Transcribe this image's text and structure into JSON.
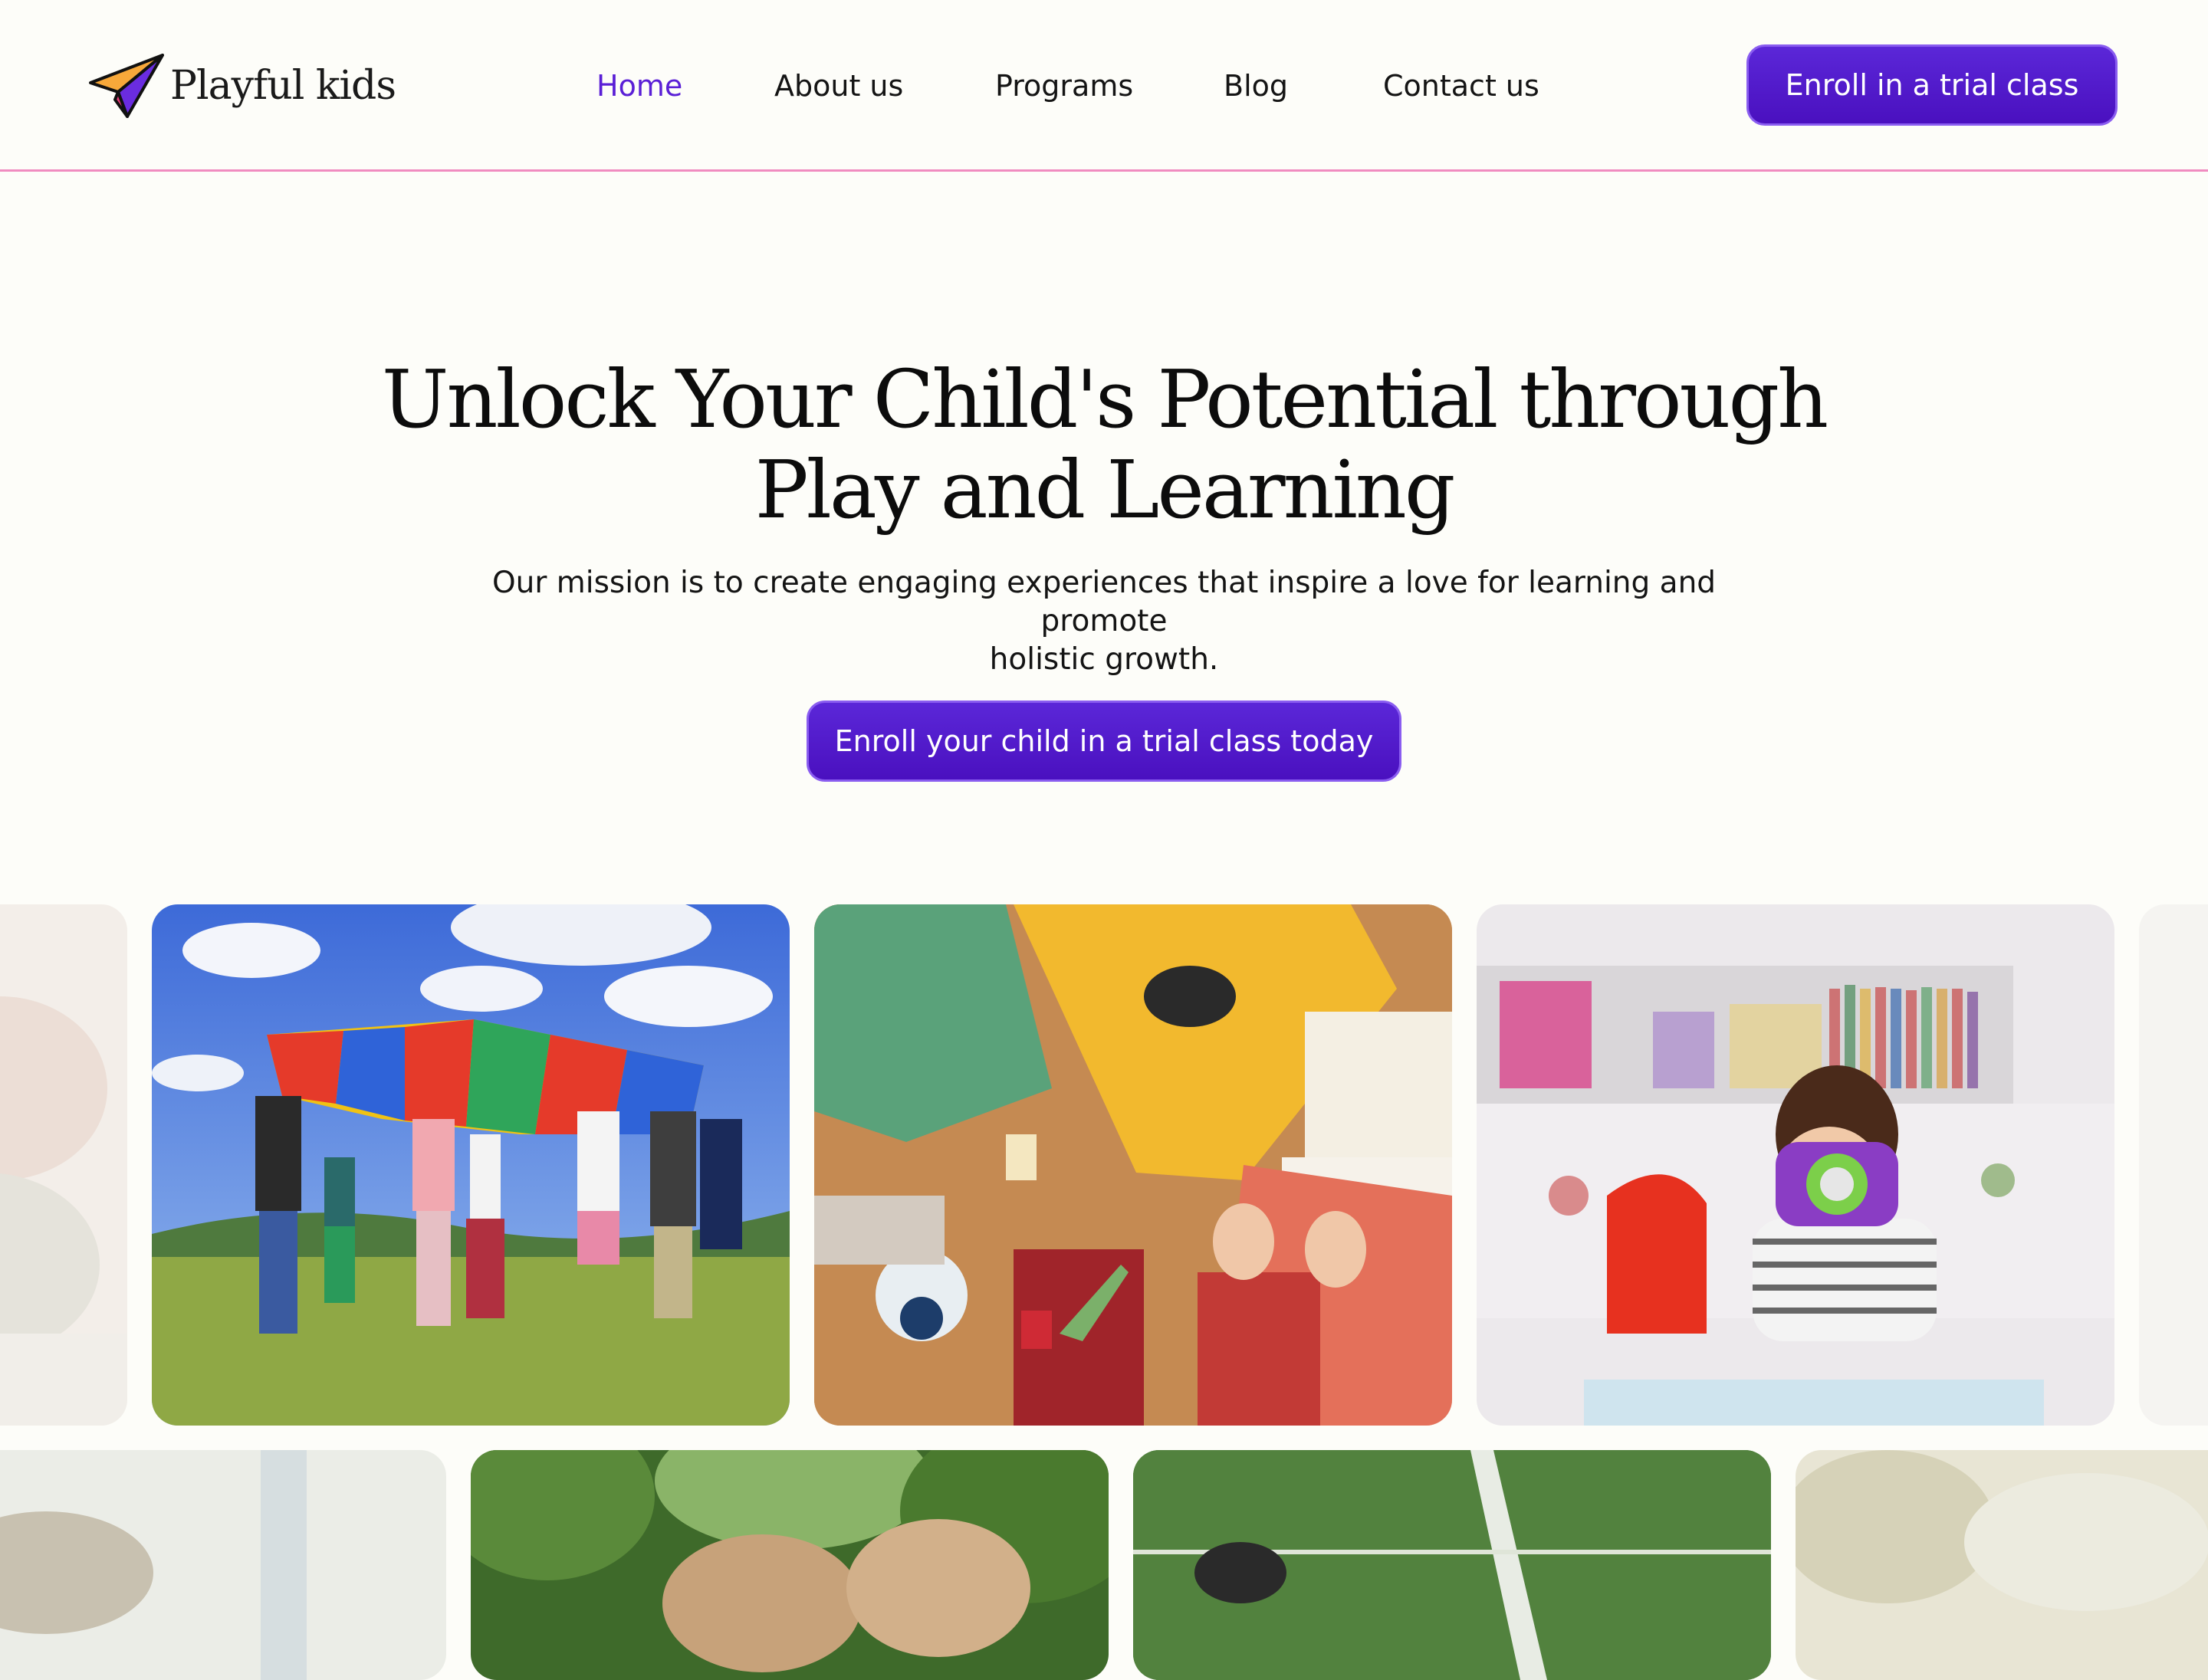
{
  "brand": {
    "name": "Playful kids",
    "colors": {
      "primary": "#4a10bf",
      "primary_light": "#8a5df0",
      "accent_line": "#f08cc0",
      "background": "#fdfdf9"
    }
  },
  "nav": {
    "items": [
      {
        "label": "Home",
        "active": true
      },
      {
        "label": "About us",
        "active": false
      },
      {
        "label": "Programs",
        "active": false
      },
      {
        "label": "Blog",
        "active": false
      },
      {
        "label": "Contact us",
        "active": false
      }
    ]
  },
  "header_cta": {
    "label": "Enroll in a trial class"
  },
  "hero": {
    "title_line1": "Unlock Your Child's Potential through",
    "title_line2": "Play and Learning",
    "subtitle_line1": "Our mission is to create engaging experiences that inspire a love for learning and promote",
    "subtitle_line2": "holistic growth.",
    "cta_label": "Enroll your child in a trial class today"
  },
  "gallery": {
    "row1": [
      {
        "name": "partial-photo-left",
        "icon": "photo-icon"
      },
      {
        "name": "children-parachute-game-photo",
        "icon": "photo-icon"
      },
      {
        "name": "arts-and-crafts-table-photo",
        "icon": "photo-icon"
      },
      {
        "name": "toddler-toy-camera-photo",
        "icon": "photo-icon"
      },
      {
        "name": "partial-photo-right",
        "icon": "photo-icon"
      }
    ],
    "row2": [
      {
        "name": "partial-photo-row2-1",
        "icon": "photo-icon"
      },
      {
        "name": "children-outdoors-photo",
        "icon": "photo-icon"
      },
      {
        "name": "soccer-field-photo",
        "icon": "photo-icon"
      },
      {
        "name": "partial-photo-row2-4",
        "icon": "photo-icon"
      }
    ]
  }
}
